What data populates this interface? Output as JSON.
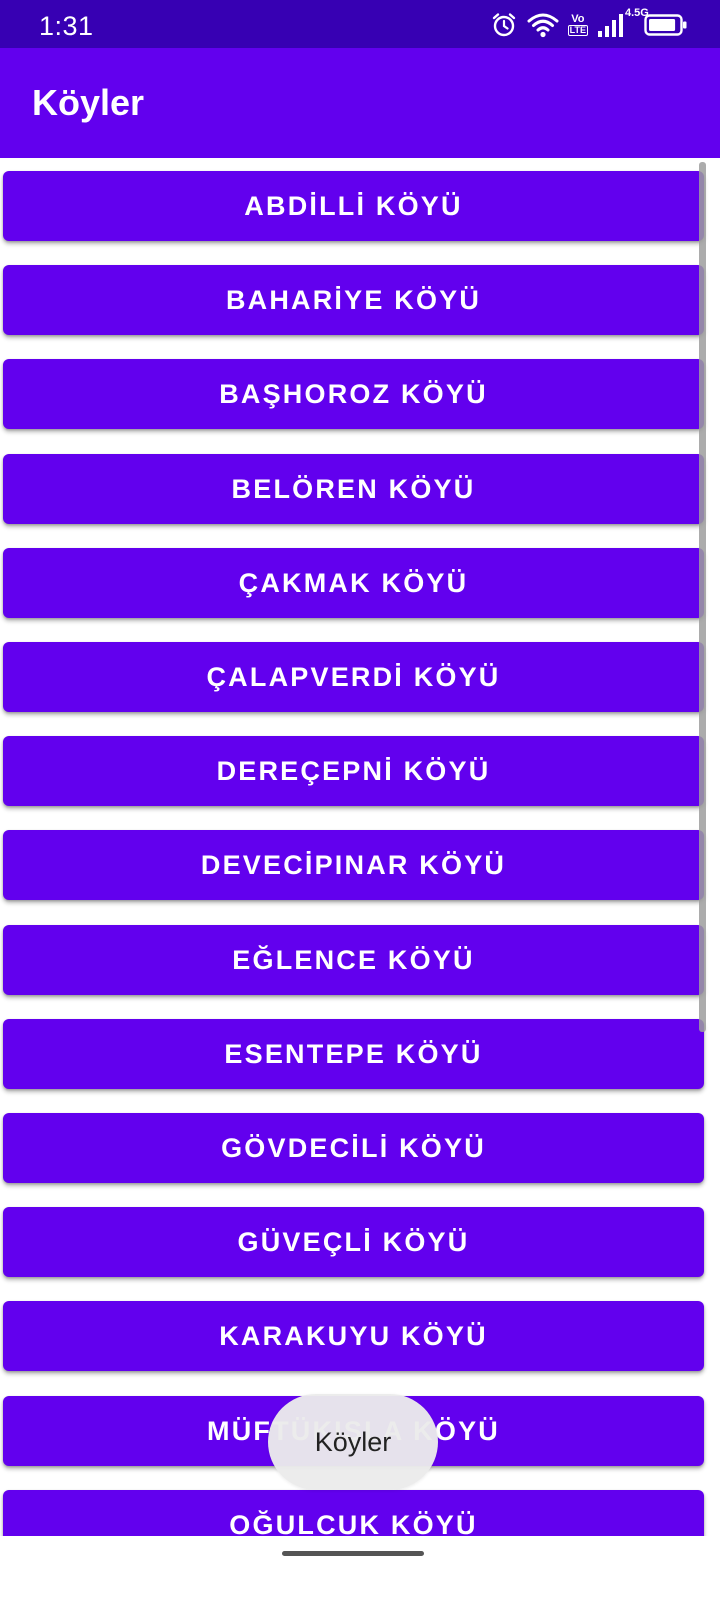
{
  "status_bar": {
    "time": "1:31",
    "network_type": "4.5G",
    "volte_top": "Vo",
    "volte_bottom": "LTE",
    "icons": [
      "alarm-icon",
      "wifi-icon",
      "volte-icon",
      "signal-icon",
      "battery-icon"
    ],
    "battery_level": 0.9
  },
  "app_bar": {
    "title": "Köyler"
  },
  "villages": [
    {
      "label": "ABDİLLİ KÖYÜ"
    },
    {
      "label": "BAHARİYE KÖYÜ"
    },
    {
      "label": "BAŞHOROZ KÖYÜ"
    },
    {
      "label": "BELÖREN KÖYÜ"
    },
    {
      "label": "ÇAKMAK KÖYÜ"
    },
    {
      "label": "ÇALAPVERDİ KÖYÜ"
    },
    {
      "label": "DEREÇEPNİ KÖYÜ"
    },
    {
      "label": "DEVECİPINAR KÖYÜ"
    },
    {
      "label": "EĞLENCE KÖYÜ"
    },
    {
      "label": "ESENTEPE KÖYÜ"
    },
    {
      "label": "GÖVDECİLİ KÖYÜ"
    },
    {
      "label": "GÜVEÇLİ KÖYÜ"
    },
    {
      "label": "KARAKUYU KÖYÜ"
    },
    {
      "label": "MÜFTÜKIŞLA KÖYÜ"
    },
    {
      "label": "OĞULCUK KÖYÜ"
    }
  ],
  "toast": {
    "text": "Köyler"
  },
  "colors": {
    "primary": "#6200EE",
    "primary_dark": "#3700B3",
    "on_primary": "#FFFFFF"
  }
}
